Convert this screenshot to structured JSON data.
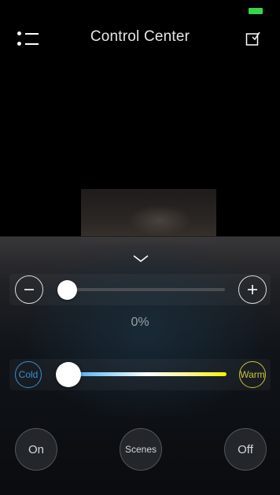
{
  "header": {
    "title": "Control Center"
  },
  "brightness": {
    "value_label": "0%",
    "value": 0
  },
  "color_temperature": {
    "cold_label": "Cold",
    "warm_label": "Warm",
    "value": 0
  },
  "actions": {
    "on_label": "On",
    "scenes_label": "Scenes",
    "off_label": "Off"
  },
  "colors": {
    "accent_cold": "#3a8ed6",
    "accent_warm": "#c9c43a",
    "battery": "#39d34a"
  },
  "icons": [
    "menu-icon",
    "edit-icon",
    "chevron-down-icon",
    "minus-icon",
    "plus-icon"
  ]
}
